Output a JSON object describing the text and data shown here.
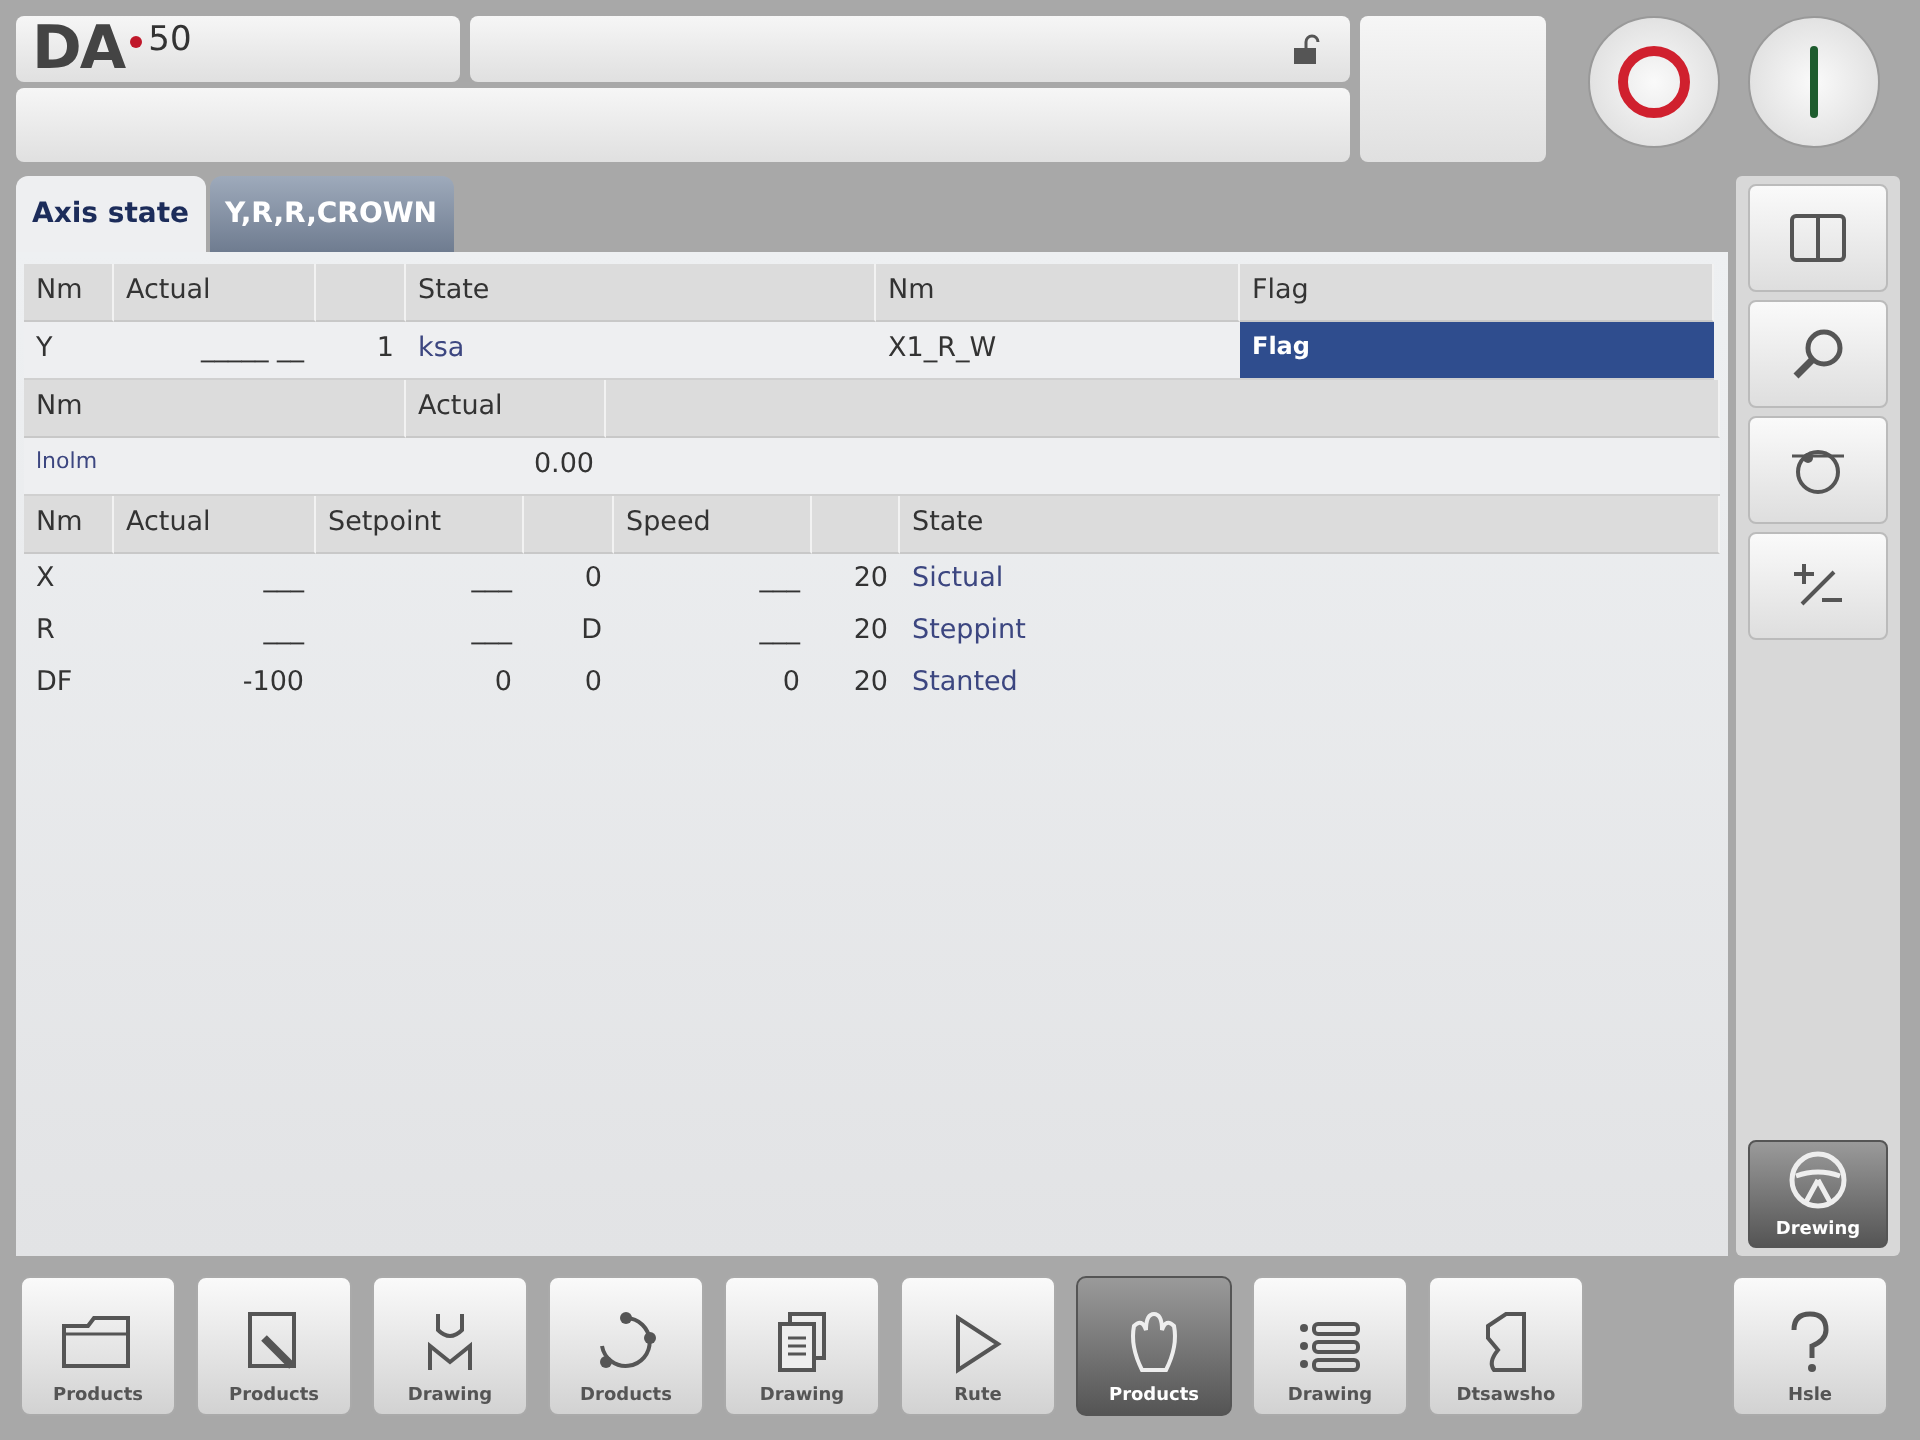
{
  "header": {
    "logo": "DA",
    "model": "50"
  },
  "tabs": [
    {
      "label": "Axis state",
      "selected": true
    },
    {
      "label": "Y,R,R,CROWN",
      "selected": false
    }
  ],
  "table_1": {
    "columns": [
      "Nm",
      "Actual",
      "",
      "State",
      "Nm",
      "Flag"
    ],
    "rows": [
      {
        "cells": [
          "Y",
          "_____ __",
          "1",
          "ksa",
          "X1_R_W",
          "Flag"
        ],
        "flag_selected": true
      }
    ]
  },
  "table_2": {
    "columns": [
      "Nm",
      "Actual"
    ],
    "rows": [
      [
        "lnolm",
        "0.00"
      ]
    ]
  },
  "table_3": {
    "columns": [
      "Nm",
      "Actual",
      "Setpoint",
      "",
      "Speed",
      "",
      "State"
    ],
    "rows": [
      [
        "X",
        "___",
        "___",
        "0",
        "___",
        "20",
        "Sictual"
      ],
      [
        "R",
        "___",
        "___",
        "D",
        "___",
        "20",
        "Steppint"
      ],
      [
        "DF",
        "-100",
        "0",
        "0",
        "0",
        "20",
        "Stanted"
      ]
    ]
  },
  "sidebar": [
    {
      "kind": "split",
      "selected": false
    },
    {
      "kind": "search",
      "selected": false
    },
    {
      "kind": "dial",
      "selected": false
    },
    {
      "kind": "plusminus",
      "selected": false
    }
  ],
  "sidebar_bottom": {
    "kind": "wheel",
    "label": "Drewing",
    "selected": true
  },
  "toolbar": [
    {
      "kind": "folder",
      "label": "Products",
      "selected": false
    },
    {
      "kind": "edit",
      "label": "Products",
      "selected": false
    },
    {
      "kind": "tool",
      "label": "Drawing",
      "selected": false
    },
    {
      "kind": "bend",
      "label": "Droducts",
      "selected": false
    },
    {
      "kind": "pages",
      "label": "Drawing",
      "selected": false
    },
    {
      "kind": "play",
      "label": "Rute",
      "selected": false
    },
    {
      "kind": "hand",
      "label": "Products",
      "selected": true
    },
    {
      "kind": "list",
      "label": "Drawing",
      "selected": false
    },
    {
      "kind": "shape",
      "label": "Dtsawsho",
      "selected": false
    },
    {
      "kind": "help",
      "label": "Hsle",
      "selected": false
    }
  ]
}
